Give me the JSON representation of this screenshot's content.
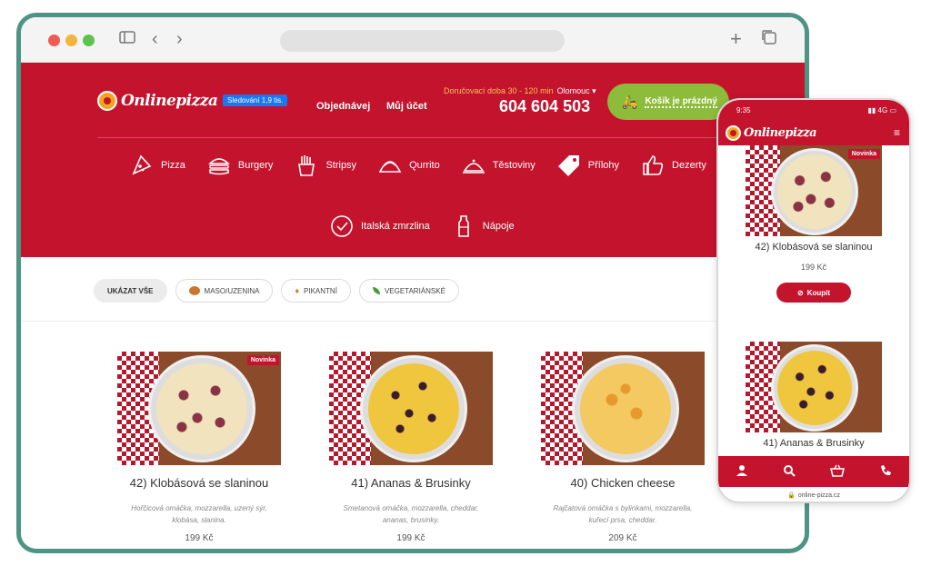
{
  "browser": {
    "colors": {
      "frame": "#4e9485",
      "brand": "#c4132d",
      "cart": "#8dbb3a"
    }
  },
  "header": {
    "logo": "Onlinepizza",
    "fb_button": "Sledování 1,9 tis.",
    "nav": [
      "Objednávej",
      "Můj účet"
    ],
    "delivery_label": "Doručovací doba 30 - 120 min",
    "city": "Olomouc ▾",
    "phone": "604 604 503",
    "cart": "Košík je prázdný"
  },
  "categories": [
    {
      "icon": "pizza-slice-icon",
      "label": "Pizza"
    },
    {
      "icon": "burger-icon",
      "label": "Burgery"
    },
    {
      "icon": "fries-icon",
      "label": "Stripsy"
    },
    {
      "icon": "taco-icon",
      "label": "Qurrito"
    },
    {
      "icon": "cloche-icon",
      "label": "Těstoviny"
    },
    {
      "icon": "tag-icon",
      "label": "Přílohy"
    },
    {
      "icon": "thumbs-up-icon",
      "label": "Dezerty"
    }
  ],
  "categories2": [
    {
      "icon": "check-circle-icon",
      "label": "Italská zmrzlina"
    },
    {
      "icon": "bottle-icon",
      "label": "Nápoje"
    }
  ],
  "filters": [
    {
      "label": "UKÁZAT VŠE",
      "icon": ""
    },
    {
      "label": "MASO/UZENINA",
      "icon": "meat-icon"
    },
    {
      "label": "PIKANTNÍ",
      "icon": "flame-icon"
    },
    {
      "label": "VEGETARIÁNSKÉ",
      "icon": "leaf-icon"
    }
  ],
  "products": [
    {
      "name": "42) Klobásová se slaninou",
      "desc": "Hořčicová omáčka, mozzarella, uzený sýr, klobása, slanina.",
      "price": "199 Kč",
      "badge": "Novinka"
    },
    {
      "name": "41) Ananas & Brusinky",
      "desc": "Smetanová omáčka, mozzarella, cheddar, ananas, brusinky.",
      "price": "199 Kč",
      "badge": ""
    },
    {
      "name": "40) Chicken cheese",
      "desc": "Rajčatová omáčka s bylinkami, mozzarella, kuřecí prsa, cheddar.",
      "price": "209 Kč",
      "badge": ""
    }
  ],
  "mobile": {
    "time": "9:35",
    "signal": "4G",
    "logo": "Onlinepizza",
    "products": [
      {
        "name": "42) Klobásová se slaninou",
        "price": "199 Kč",
        "badge": "Novinka",
        "buy": "Koupit"
      },
      {
        "name": "41) Ananas & Brusinky"
      }
    ],
    "url": "online-pizza.cz",
    "tabs": [
      "user-icon",
      "search-icon",
      "basket-icon",
      "phone-icon"
    ]
  }
}
